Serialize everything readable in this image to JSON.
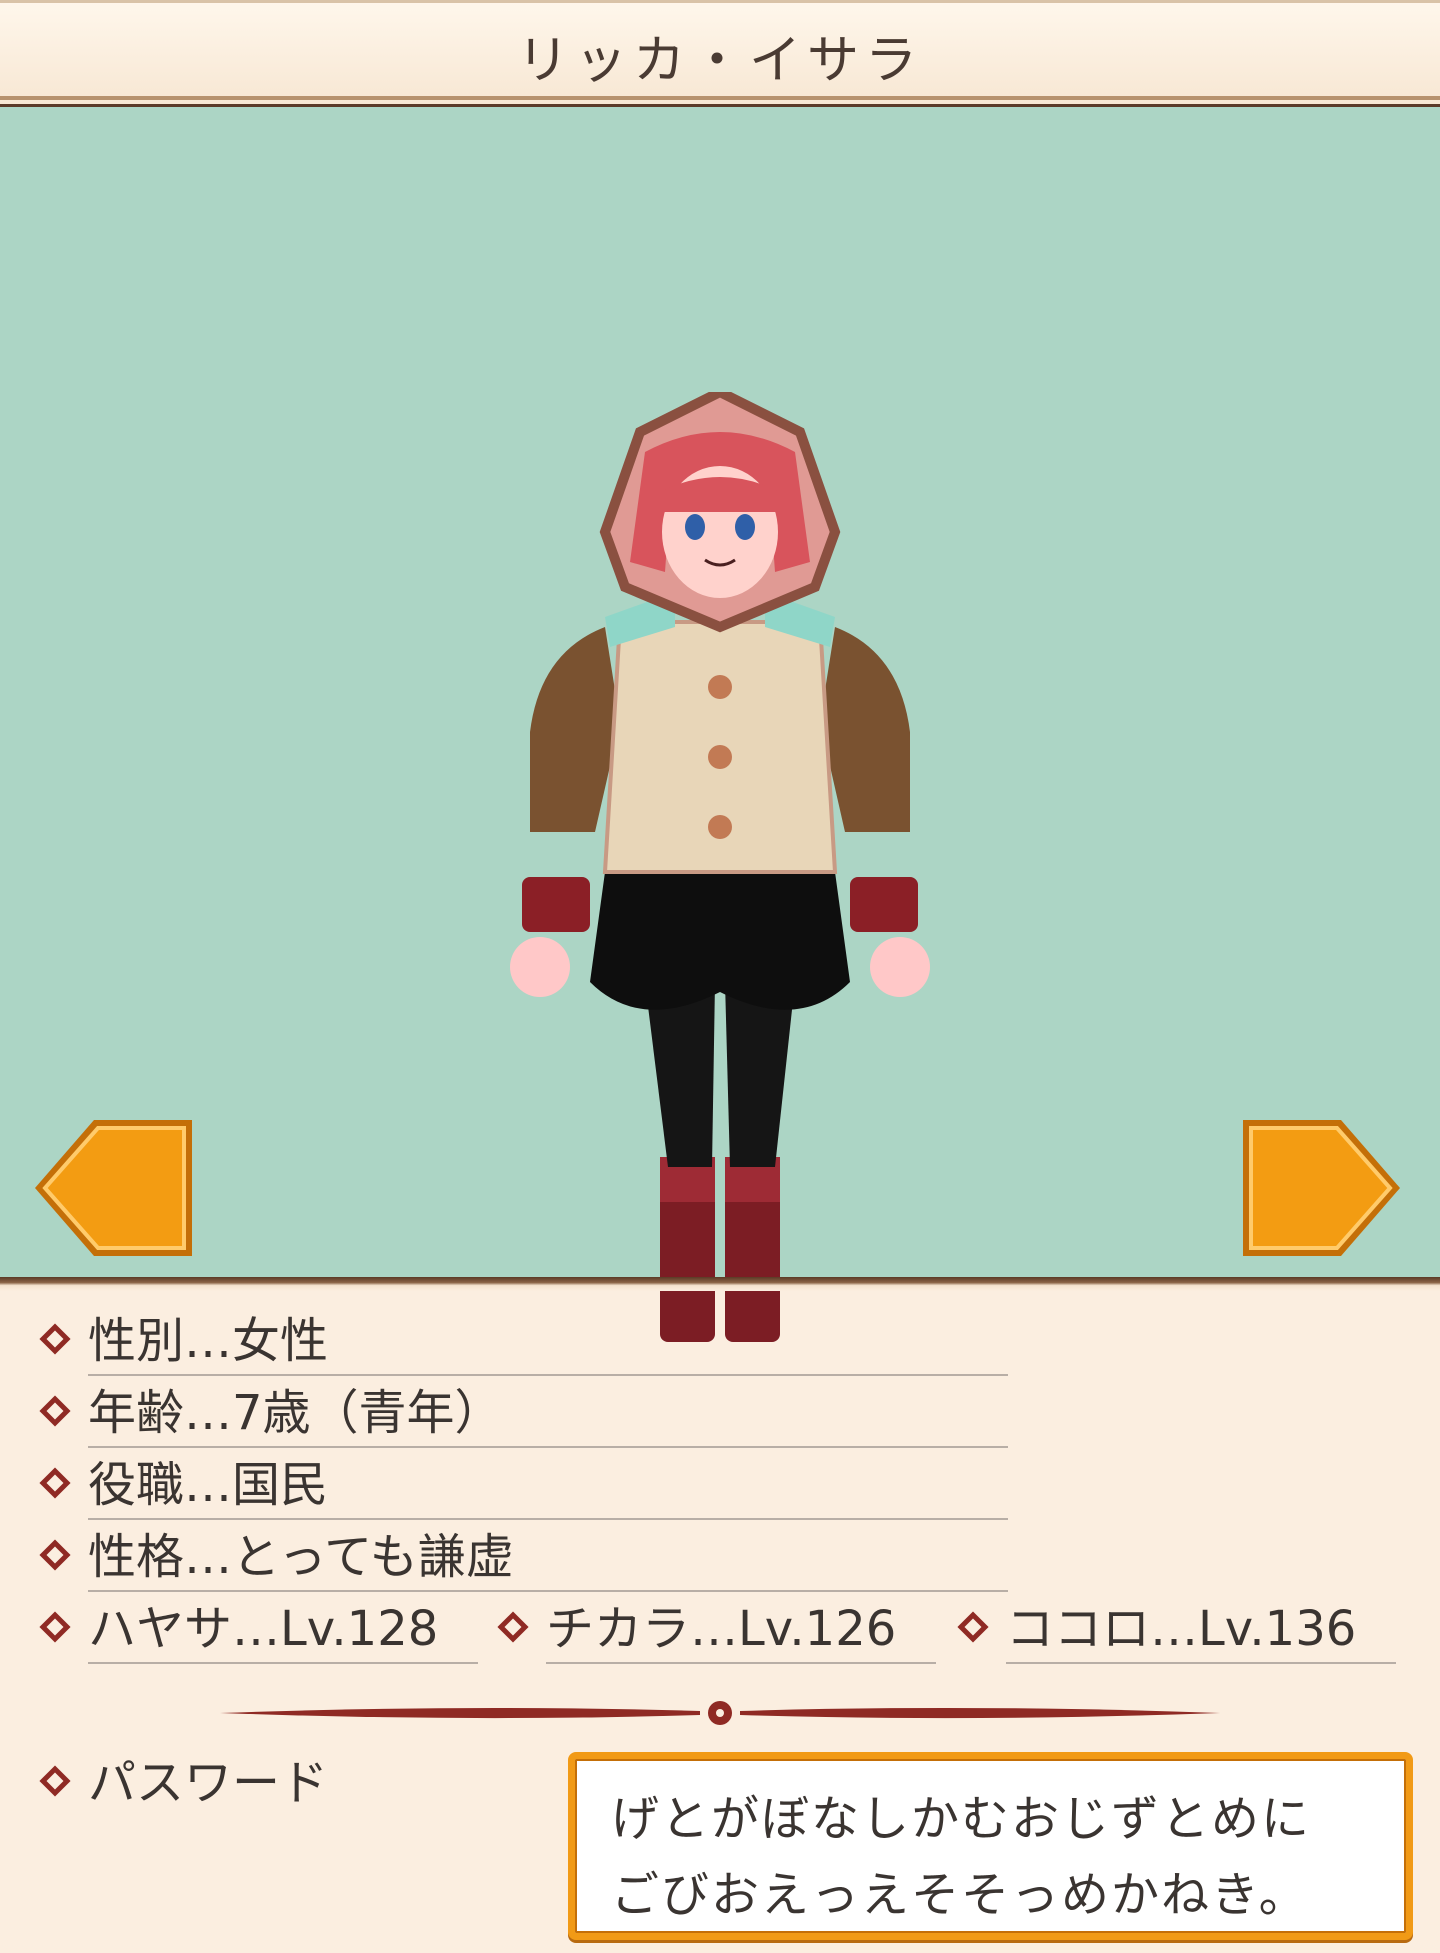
{
  "header": {
    "title": "リッカ・イサラ"
  },
  "nav": {
    "prev_icon": "left-arrow-icon",
    "next_icon": "right-arrow-icon",
    "accent": "#f39c12"
  },
  "profile": {
    "gender": "性別…女性",
    "age": "年齢…7歳（青年）",
    "role": "役職…国民",
    "personality": "性格…とっても謙虚"
  },
  "stats": [
    {
      "label": "ハヤサ…Lv.128"
    },
    {
      "label": "チカラ…Lv.126"
    },
    {
      "label": "ココロ…Lv.136"
    }
  ],
  "password": {
    "label": "パスワード",
    "line1": "げとがぼなしかむおじずとめに",
    "line2": "ごびおえっえそそっめかねき。"
  },
  "colors": {
    "viewport_bg": "#acd5c5",
    "panel_bg": "#fbeee0",
    "diamond": "#8f2a24"
  }
}
